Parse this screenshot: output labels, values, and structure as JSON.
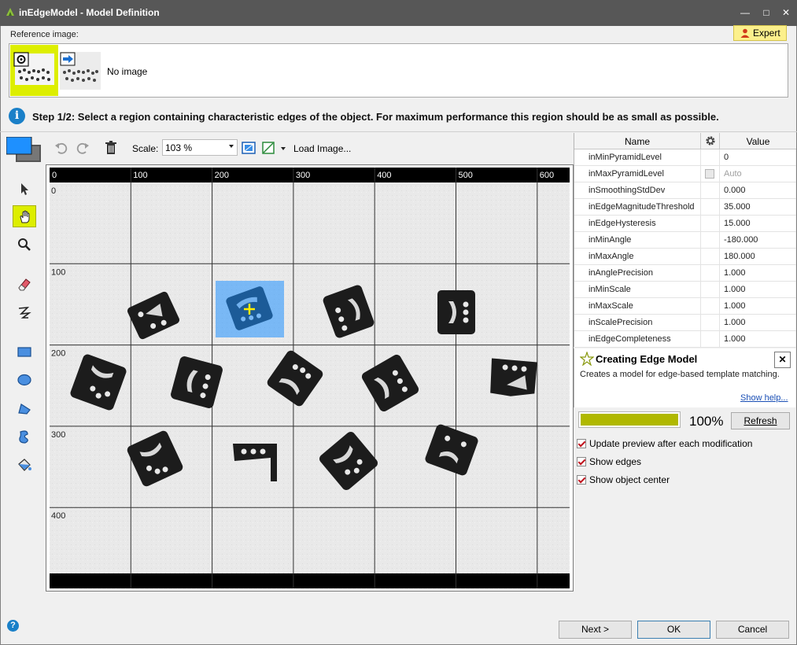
{
  "window": {
    "title": "inEdgeModel - Model Definition",
    "minimize_glyph": "—",
    "maximize_glyph": "□",
    "close_glyph": "✕"
  },
  "reference": {
    "label": "Reference image:",
    "expert_label": "Expert",
    "no_image": "No image"
  },
  "step_text": "Step 1/2: Select a region containing characteristic edges of the object. For maximum performance this region should be as small as possible.",
  "toolbar": {
    "scale_label": "Scale:",
    "scale_value": "103 %",
    "load_image": "Load Image..."
  },
  "ruler": {
    "x_ticks": [
      "0",
      "100",
      "200",
      "300",
      "400",
      "500",
      "600"
    ],
    "y_ticks": [
      "0",
      "100",
      "200",
      "300",
      "400"
    ]
  },
  "property_grid": {
    "col_name": "Name",
    "col_value": "Value",
    "rows": [
      {
        "name": "inMinPyramidLevel",
        "value": "0"
      },
      {
        "name": "inMaxPyramidLevel",
        "value": "Auto"
      },
      {
        "name": "inSmoothingStdDev",
        "value": "0.000"
      },
      {
        "name": "inEdgeMagnitudeThreshold",
        "value": "35.000"
      },
      {
        "name": "inEdgeHysteresis",
        "value": "15.000"
      },
      {
        "name": "inMinAngle",
        "value": "-180.000"
      },
      {
        "name": "inMaxAngle",
        "value": "180.000"
      },
      {
        "name": "inAnglePrecision",
        "value": "1.000"
      },
      {
        "name": "inMinScale",
        "value": "1.000"
      },
      {
        "name": "inMaxScale",
        "value": "1.000"
      },
      {
        "name": "inScalePrecision",
        "value": "1.000"
      },
      {
        "name": "inEdgeCompleteness",
        "value": "1.000"
      }
    ]
  },
  "help": {
    "title": "Creating Edge Model",
    "description": "Creates a model for edge-based template matching.",
    "show_help": "Show help...",
    "close_glyph": "✕"
  },
  "progress": {
    "percent_label": "100%",
    "fraction": 1.0,
    "refresh_label": "Refresh"
  },
  "options": [
    {
      "label": "Update preview after each modification",
      "checked": true
    },
    {
      "label": "Show edges",
      "checked": true
    },
    {
      "label": "Show object center",
      "checked": true
    }
  ],
  "buttons": {
    "next": "Next >",
    "ok": "OK",
    "cancel": "Cancel"
  },
  "colors": {
    "accent_yellow": "#ddee00",
    "selection_blue": "#1e90ff",
    "progress_fill": "#b0b800"
  }
}
